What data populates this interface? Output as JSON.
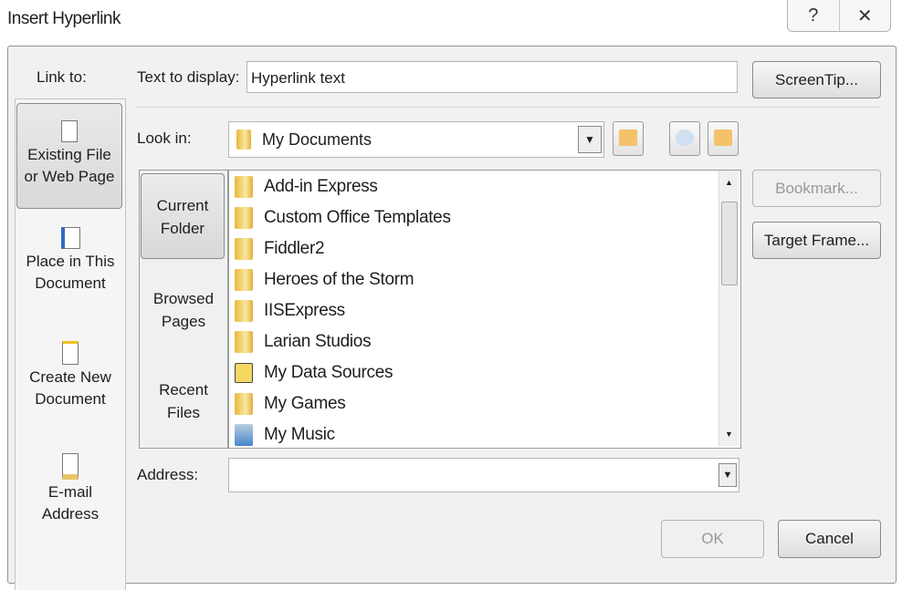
{
  "window": {
    "title": "Insert Hyperlink",
    "help_icon": "?",
    "close_icon": "✕"
  },
  "link_to": {
    "label": "Link to:",
    "items": [
      {
        "line1": "Existing File",
        "line2": "or Web Page",
        "icon": "web-page-icon",
        "selected": true
      },
      {
        "line1": "Place in This",
        "line2": "Document",
        "icon": "place-in-document-icon",
        "selected": false
      },
      {
        "line1": "Create New",
        "line2": "Document",
        "icon": "new-document-icon",
        "selected": false
      },
      {
        "line1": "E-mail",
        "line2": "Address",
        "icon": "email-icon",
        "selected": false
      }
    ]
  },
  "text_to_display": {
    "label": "Text to display:",
    "value": "Hyperlink text"
  },
  "screentip_label": "ScreenTip...",
  "look_in": {
    "label": "Look in:",
    "value": "My Documents"
  },
  "nav": [
    {
      "line1": "Current",
      "line2": "Folder",
      "selected": true
    },
    {
      "line1": "Browsed",
      "line2": "Pages"
    },
    {
      "line1": "Recent",
      "line2": "Files"
    }
  ],
  "files": [
    {
      "name": "Add-in Express",
      "icon": "folder"
    },
    {
      "name": "Custom Office Templates",
      "icon": "folder"
    },
    {
      "name": "Fiddler2",
      "icon": "folder"
    },
    {
      "name": "Heroes of the Storm",
      "icon": "folder"
    },
    {
      "name": "IISExpress",
      "icon": "folder"
    },
    {
      "name": "Larian Studios",
      "icon": "folder"
    },
    {
      "name": "My Data Sources",
      "icon": "data-sources-folder"
    },
    {
      "name": "My Games",
      "icon": "folder"
    },
    {
      "name": "My Music",
      "icon": "music-folder"
    }
  ],
  "bookmark_label": "Bookmark...",
  "target_frame_label": "Target Frame...",
  "address": {
    "label": "Address:",
    "value": ""
  },
  "ok_label": "OK",
  "cancel_label": "Cancel"
}
